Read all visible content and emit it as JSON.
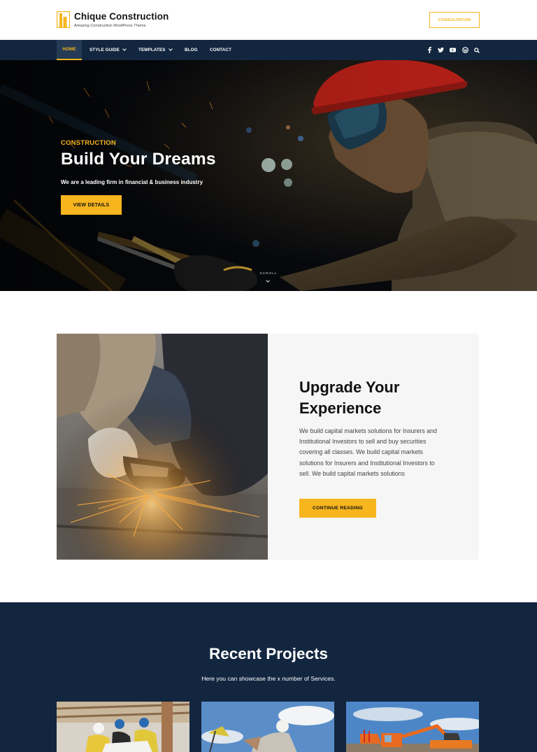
{
  "header": {
    "site_title": "Chique Construction",
    "tagline": "Amazing Construction WordPress Theme",
    "cta_label": "CONSULTATION",
    "logo_icon": "building-logo-icon"
  },
  "nav": {
    "items": [
      {
        "label": "HOME",
        "active": true
      },
      {
        "label": "STYLE GUIDE",
        "dropdown": true
      },
      {
        "label": "TEMPLATES",
        "dropdown": true
      },
      {
        "label": "BLOG"
      },
      {
        "label": "CONTACT"
      }
    ],
    "social_icons": [
      "facebook-icon",
      "twitter-icon",
      "youtube-icon",
      "wordpress-icon",
      "search-icon"
    ]
  },
  "hero": {
    "kicker": "CONSTRUCTION",
    "title": "Build Your Dreams",
    "subtitle": "We are a leading firm in financial & business industry",
    "button_label": "VIEW DETAILS",
    "scroll_label": "SCROLL"
  },
  "feature": {
    "title_line1": "Upgrade Your",
    "title_line2": "Experience",
    "body": "We build capital markets solutions for Insurers and Institutional Investors to sell and buy securities covering all classes. We build capital markets solutions for Insurers and Institutional Investors to sell. We build capital markets solutions",
    "button_label": "CONTINUE READING"
  },
  "projects": {
    "title": "Recent Projects",
    "subtitle": "Here you can showcase the x number of Services."
  },
  "colors": {
    "accent": "#f7b51e",
    "navy": "#12263f",
    "panel": "#f6f6f6"
  }
}
